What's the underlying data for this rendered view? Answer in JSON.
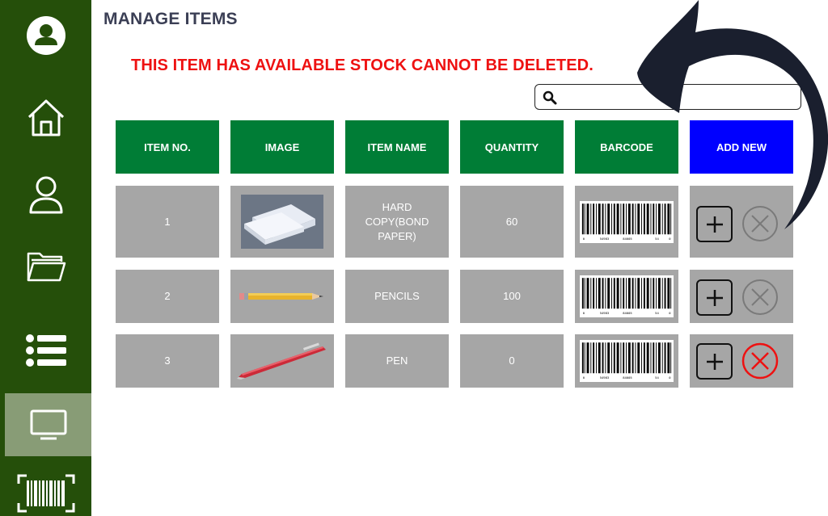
{
  "page": {
    "title": "MANAGE ITEMS",
    "error_message": "THIS ITEM HAS AVAILABLE STOCK CANNOT BE DELETED."
  },
  "sidebar": {
    "items": [
      {
        "name": "profile",
        "icon": "user-circle-icon"
      },
      {
        "name": "home",
        "icon": "home-icon"
      },
      {
        "name": "users",
        "icon": "user-icon"
      },
      {
        "name": "folder",
        "icon": "folder-icon"
      },
      {
        "name": "list",
        "icon": "list-icon"
      },
      {
        "name": "monitor",
        "icon": "monitor-icon",
        "active": true
      },
      {
        "name": "barcode-scan",
        "icon": "barcode-scan-icon"
      }
    ]
  },
  "search": {
    "placeholder": "",
    "value": "",
    "icon": "search-icon"
  },
  "table": {
    "headers": [
      "ITEM NO.",
      "IMAGE",
      "ITEM NAME",
      "QUANTITY",
      "BARCODE",
      "ADD NEW"
    ],
    "rows": [
      {
        "item_no": "1",
        "image": "paper-stack",
        "item_name": "HARD COPY(BOND PAPER)",
        "quantity": "60",
        "barcode": [
          "0",
          "54983",
          "84005",
          "54",
          "0"
        ],
        "delete_enabled": false
      },
      {
        "item_no": "2",
        "image": "pencil",
        "item_name": "PENCILS",
        "quantity": "100",
        "barcode": [
          "0",
          "54983",
          "84005",
          "54",
          "0"
        ],
        "delete_enabled": false
      },
      {
        "item_no": "3",
        "image": "pen",
        "item_name": "PEN",
        "quantity": "0",
        "barcode": [
          "0",
          "54983",
          "84005",
          "54",
          "0"
        ],
        "delete_enabled": true
      }
    ]
  },
  "colors": {
    "sidebar": "#254f0a",
    "sidebar_active": "#889c76",
    "header_green": "#007d36",
    "header_blue": "#0000ff",
    "cell_gray": "#a6a6a6",
    "error_red": "#ee1111",
    "delete_active_red": "#ee1111"
  }
}
